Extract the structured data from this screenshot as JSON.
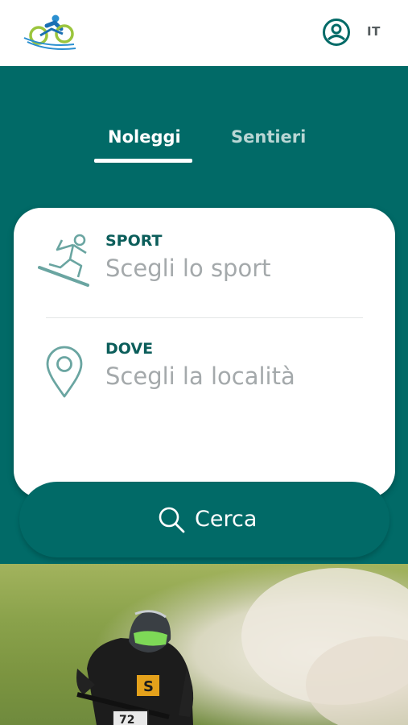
{
  "header": {
    "logo_icon": "cyclist-logo-icon",
    "user_icon": "user-circle-icon",
    "language": "IT"
  },
  "tabs": [
    {
      "label": "Noleggi",
      "active": true
    },
    {
      "label": "Sentieri",
      "active": false
    }
  ],
  "search_form": {
    "sport": {
      "label": "SPORT",
      "value": "Scegli lo sport",
      "icon": "snowboarder-icon"
    },
    "dove": {
      "label": "DOVE",
      "value": "Scegli la località",
      "icon": "location-pin-icon"
    },
    "button_label": "Cerca",
    "button_icon": "search-icon"
  },
  "colors": {
    "primary": "#016a67",
    "label": "#0c5e5b",
    "placeholder": "#a4a9ab",
    "tab_inactive": "#b9d6d4"
  },
  "hero_image": {
    "subject": "mountain-biker-photo"
  }
}
